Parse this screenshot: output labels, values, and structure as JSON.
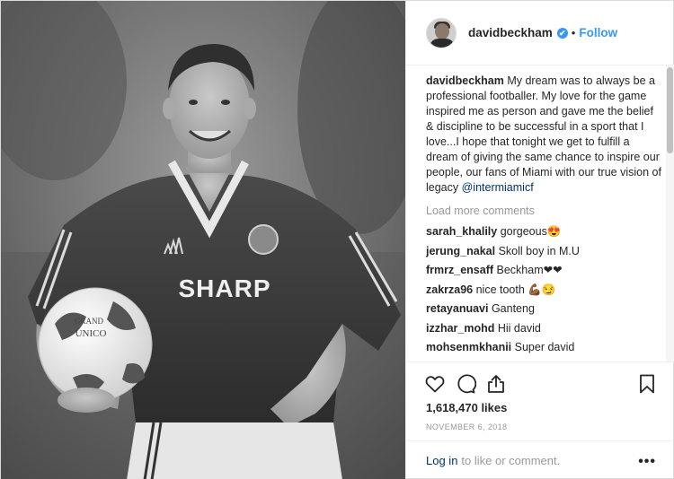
{
  "post": {
    "username": "davidbeckham",
    "follow_label": "Follow",
    "separator": "•",
    "verified_mark": "✔",
    "avatar_icon": "avatar",
    "photo": {
      "jersey_text": "SHARP",
      "ball_text_1": "GRAND",
      "ball_text_2": "UNICO"
    }
  },
  "caption": {
    "username": "davidbeckham",
    "text": " My dream was to always be a professional footballer. My love for the game inspired me as person and gave me the belief & discipline to be successful in a sport that I love...I hope that tonight we get to fulfill a dream of giving the same chance to inspire our people, our fans of Miami with our true vision of legacy ",
    "mention": "@intermiamicf"
  },
  "load_more_label": "Load more comments",
  "comments": [
    {
      "username": "sarah_khalily",
      "text": " gorgeous😍"
    },
    {
      "username": "jerung_nakal",
      "text": " Skoll boy in M.U"
    },
    {
      "username": "frmrz_ensaff",
      "text": " Beckham❤❤"
    },
    {
      "username": "zakrza96",
      "text": " nice tooth 💪🏾😏"
    },
    {
      "username": "retayanuavi",
      "text": " Ganteng"
    },
    {
      "username": "izzhar_mohd",
      "text": " Hii david"
    },
    {
      "username": "mohsenmkhanii",
      "text": " Super david"
    }
  ],
  "actions": {
    "icons": [
      "heart-icon",
      "comment-icon",
      "share-icon",
      "bookmark-icon"
    ],
    "likes": "1,618,470 likes",
    "date": "NOVEMBER 6, 2018"
  },
  "footer": {
    "login_label": "Log in",
    "rest_text": "to like or comment.",
    "more_label": "•••"
  },
  "colors": {
    "accent": "#3897f0",
    "text": "#262626",
    "muted": "#999999",
    "link": "#003569"
  }
}
